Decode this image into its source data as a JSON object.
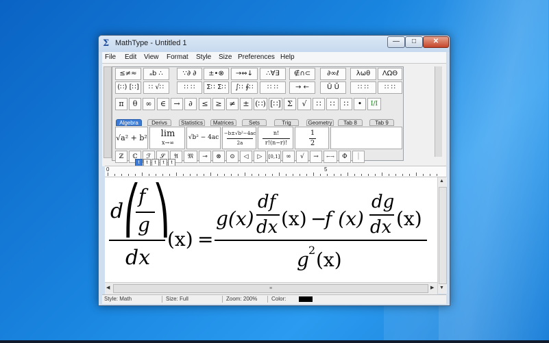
{
  "window": {
    "title": "MathType - Untitled 1",
    "controls": {
      "minimize": "—",
      "maximize": "□",
      "close": "✕"
    }
  },
  "menu": [
    "File",
    "Edit",
    "View",
    "Format",
    "Style",
    "Size",
    "Preferences",
    "Help"
  ],
  "palette_row1": [
    "≤≠≈",
    "ₐb ∴",
    "∵∂ ∂",
    "±•⊗",
    "→⇔↓",
    "∴∀∃",
    "∉∩⊂",
    "∂∞ℓ",
    "λωθ",
    "ΛΩΘ"
  ],
  "palette_row2": [
    "(∷) [∷]",
    "∷ √∷",
    "∷ ∷",
    "Σ∷ Σ∷",
    "∫∷ ∮∷",
    "∷ ∷",
    "→ ←",
    "Ū Ŭ",
    "∷ ∷",
    "∷ ∷"
  ],
  "symbol_row": [
    "π",
    "θ",
    "∞",
    "∈",
    "→",
    "∂",
    "≤",
    "≥",
    "≠",
    "±",
    "(∷)",
    "[∷]",
    "Σ",
    "√",
    "∷",
    "∷",
    "∷",
    "•",
    "I/I"
  ],
  "tabs": [
    "Algebra",
    "Derivs",
    "Statistics",
    "Matrices",
    "Sets",
    "Trig",
    "Geometry",
    "Tab 8",
    "Tab 9"
  ],
  "templates": {
    "pythag": "√a² + b²",
    "lim_top": "lim",
    "lim_bottom": "x→∞",
    "sqrt_expr": "√b² − 4ac",
    "quad_top": "−b±√b²−4ac",
    "quad_bottom": "2a",
    "binom_top": "n!",
    "binom_bottom": "r!(n−r)!",
    "half_top": "1",
    "half_bottom": "2"
  },
  "bottom_row": [
    "ℤ",
    "ℂ",
    "ℱ",
    "𝒮",
    "𝔄",
    "𝔐",
    "⊸",
    "⊗",
    "⊙",
    "◁",
    "▷",
    "[0,1]",
    "∞",
    "√",
    "→",
    "←→",
    "Φ",
    "│"
  ],
  "size_buttons": [
    "t",
    "t",
    "t",
    "t",
    "t"
  ],
  "ruler": {
    "mark0": "0",
    "mark5": "5"
  },
  "equation": {
    "d": "d",
    "f": "f",
    "g": "g",
    "dx": "dx",
    "x_paren": "(x)",
    "equals": "=",
    "num_left": "g(x)",
    "df": "df",
    "minus": "−",
    "f_x": "f (x)",
    "dg": "dg",
    "g2": "g",
    "sup2": "2",
    "lparen": "⎛",
    "rparen": "⎞"
  },
  "status": {
    "style": "Style: Math",
    "size": "Size: Full",
    "zoom": "Zoom: 200%",
    "color": "Color:"
  },
  "colors": {
    "accent": "#3b7bd6",
    "swatch": "#000000"
  }
}
